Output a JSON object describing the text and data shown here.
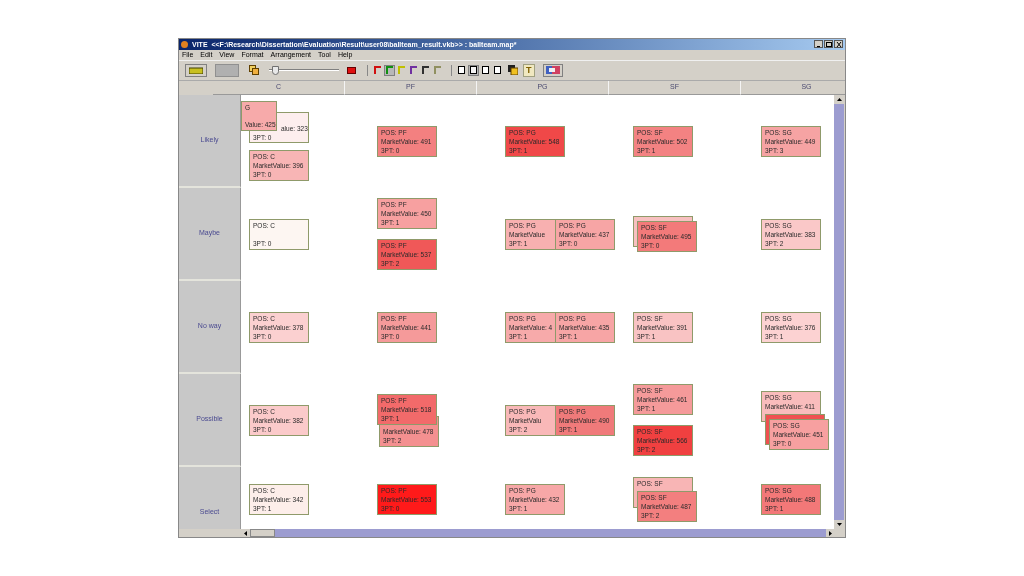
{
  "window": {
    "title": "VITE  <<F:\\Research\\Dissertation\\Evaluation\\Result\\user08\\ballteam_result.vkb>> : ballteam.map*"
  },
  "menu": [
    "File",
    "Edit",
    "View",
    "Format",
    "Arrangement",
    "Tool",
    "Help"
  ],
  "toolbar": {
    "zoom_slider": {
      "level": 0.05
    },
    "line_colors": [
      {
        "color": "#d01010",
        "selected": false
      },
      {
        "color": "#109010",
        "selected": true
      },
      {
        "color": "#c0c000",
        "selected": false
      },
      {
        "color": "#7030a0",
        "selected": false
      },
      {
        "color": "#303030",
        "selected": false
      },
      {
        "color": "#909060",
        "selected": false
      }
    ],
    "fill_colors": [
      {
        "color": "#ffffff",
        "selected": false
      },
      {
        "color": "#f4f4f4",
        "selected": true
      },
      {
        "color": "#ffffff",
        "selected": false
      },
      {
        "color": "#ffffff",
        "selected": false
      }
    ],
    "text_tool": "T"
  },
  "columns": [
    "C",
    "PF",
    "PG",
    "SF",
    "SG"
  ],
  "rows": [
    {
      "label": "Likely",
      "cells": [
        [
          {
            "kind": "corner",
            "cards": [
              {
                "lines": [
                  "G",
                  "Value: 425"
                ],
                "color": "#f7aaaa"
              },
              {
                "lines": [
                  "alue: 323",
                  "3PT: 0"
                ],
                "color": "#fdeeee"
              }
            ]
          },
          {
            "kind": "single",
            "cards": [
              {
                "lines": [
                  "POS: C",
                  "MarketValue: 396",
                  "3PT: 0"
                ],
                "color": "#f8b5b5"
              }
            ]
          }
        ],
        [
          {
            "kind": "single",
            "cards": [
              {
                "lines": [
                  "POS: PF",
                  "MarketValue: 491",
                  "3PT: 0"
                ],
                "color": "#f38080"
              }
            ]
          }
        ],
        [
          {
            "kind": "single",
            "cards": [
              {
                "lines": [
                  "POS: PG",
                  "MarketValue: 548",
                  "3PT: 1"
                ],
                "color": "#f04848"
              }
            ]
          }
        ],
        [
          {
            "kind": "single",
            "cards": [
              {
                "lines": [
                  "POS: SF",
                  "MarketValue: 502",
                  "3PT: 1"
                ],
                "color": "#f38282"
              }
            ]
          }
        ],
        [
          {
            "kind": "single",
            "cards": [
              {
                "lines": [
                  "POS: SG",
                  "MarketValue: 449",
                  "3PT: 3"
                ],
                "color": "#f6a3a3"
              }
            ]
          }
        ]
      ]
    },
    {
      "label": "Maybe",
      "cells": [
        [
          {
            "kind": "single",
            "cards": [
              {
                "lines": [
                  "POS: C",
                  "3PT: 0"
                ],
                "color": "#fdf6f2"
              }
            ]
          }
        ],
        [
          {
            "kind": "single",
            "cards": [
              {
                "lines": [
                  "POS: PF",
                  "MarketValue: 450",
                  "3PT: 1"
                ],
                "color": "#f7a0a0"
              }
            ]
          },
          {
            "kind": "single",
            "cards": [
              {
                "lines": [
                  "POS: PF",
                  "MarketValue: 537",
                  "3PT: 2"
                ],
                "color": "#f05858"
              }
            ]
          }
        ],
        [
          {
            "kind": "right",
            "cards": [
              {
                "lines": [
                  "POS: PG",
                  "MarketValue",
                  "3PT: 1"
                ],
                "color": "#f8b0b0"
              },
              {
                "lines": [
                  "POS: PG",
                  "MarketValue: 437",
                  "3PT: 0"
                ],
                "color": "#f7a5a5"
              }
            ]
          }
        ],
        [
          {
            "kind": "down",
            "cards": [
              {
                "color": "#f8c0c0"
              },
              {
                "lines": [
                  "POS: SF",
                  "MarketValue: 495",
                  "3PT: 0"
                ],
                "color": "#f37a7a"
              }
            ]
          }
        ],
        [
          {
            "kind": "single",
            "cards": [
              {
                "lines": [
                  "POS: SG",
                  "MarketValue: 383",
                  "3PT: 2"
                ],
                "color": "#fac8c8"
              }
            ]
          }
        ]
      ]
    },
    {
      "label": "No way",
      "cells": [
        [
          {
            "kind": "single",
            "cards": [
              {
                "lines": [
                  "POS: C",
                  "MarketValue: 378",
                  "3PT: 0"
                ],
                "color": "#fbd0d0"
              }
            ]
          }
        ],
        [
          {
            "kind": "single",
            "cards": [
              {
                "lines": [
                  "POS: PF",
                  "MarketValue: 441",
                  "3PT: 0"
                ],
                "color": "#f59a9a"
              }
            ]
          }
        ],
        [
          {
            "kind": "right",
            "cards": [
              {
                "lines": [
                  "POS: PG",
                  "MarketValue: 4",
                  "3PT: 1"
                ],
                "color": "#f7aaaa"
              },
              {
                "lines": [
                  "POS: PG",
                  "MarketValue: 435",
                  "3PT: 1"
                ],
                "color": "#f7a5a5"
              }
            ]
          }
        ],
        [
          {
            "kind": "single",
            "cards": [
              {
                "lines": [
                  "POS: SF",
                  "MarketValue: 391",
                  "3PT: 1"
                ],
                "color": "#f9c3c3"
              }
            ]
          }
        ],
        [
          {
            "kind": "single",
            "cards": [
              {
                "lines": [
                  "POS: SG",
                  "MarketValue: 376",
                  "3PT: 1"
                ],
                "color": "#fcd2d2"
              }
            ]
          }
        ]
      ]
    },
    {
      "label": "Possible",
      "cells": [
        [
          {
            "kind": "single",
            "cards": [
              {
                "lines": [
                  "POS: C",
                  "MarketValue: 382",
                  "3PT: 0"
                ],
                "color": "#fbcaca"
              }
            ]
          }
        ],
        [
          {
            "kind": "up",
            "cards": [
              {
                "lines": [
                  "POS: PF",
                  "MarketValue: 518",
                  "3PT: 1"
                ],
                "color": "#f26a6a"
              },
              {
                "lines": [
                  "MarketValue: 478",
                  "3PT: 2"
                ],
                "color": "#f49090"
              }
            ]
          }
        ],
        [
          {
            "kind": "right",
            "cards": [
              {
                "lines": [
                  "POS: PG",
                  "MarketValu",
                  "3PT: 2"
                ],
                "color": "#f9b8b8"
              },
              {
                "lines": [
                  "POS: PG",
                  "MarketValue: 490",
                  "3PT: 1"
                ],
                "color": "#f07a7a"
              }
            ]
          }
        ],
        [
          {
            "kind": "single",
            "cards": [
              {
                "lines": [
                  "POS: SF",
                  "MarketValue: 461",
                  "3PT: 1"
                ],
                "color": "#f59a9a"
              }
            ]
          },
          {
            "kind": "single",
            "cards": [
              {
                "lines": [
                  "POS: SF",
                  "MarketValue: 566",
                  "3PT: 2"
                ],
                "color": "#f04040"
              }
            ]
          }
        ],
        [
          {
            "kind": "down",
            "cards": [
              {
                "lines": [
                  "POS: SG",
                  "MarketValue: 411"
                ],
                "color": "#f9bcbc"
              },
              {
                "color": "#f05050"
              },
              {
                "lines": [
                  "POS: SG",
                  "MarketValue: 451",
                  "3PT: 0"
                ],
                "color": "#f7a0a0"
              }
            ]
          }
        ]
      ]
    },
    {
      "label": "Select",
      "cells": [
        [
          {
            "kind": "single",
            "cards": [
              {
                "lines": [
                  "POS: C",
                  "MarketValue: 342",
                  "3PT: 1"
                ],
                "color": "#fdeeea"
              }
            ]
          }
        ],
        [
          {
            "kind": "single",
            "cards": [
              {
                "lines": [
                  "POS: PF",
                  "MarketValue: 553",
                  "3PT: 0"
                ],
                "color": "#ff1a1a"
              }
            ]
          }
        ],
        [
          {
            "kind": "single",
            "cards": [
              {
                "lines": [
                  "POS: PG",
                  "MarketValue: 432",
                  "3PT: 1"
                ],
                "color": "#f7a7a7"
              }
            ]
          }
        ],
        [
          {
            "kind": "down",
            "cards": [
              {
                "lines": [
                  "POS: SF"
                ],
                "color": "#f8b5b5"
              },
              {
                "lines": [
                  "POS: SF",
                  "MarketValue: 487",
                  "3PT: 2"
                ],
                "color": "#f37f7f"
              }
            ]
          }
        ],
        [
          {
            "kind": "single",
            "cards": [
              {
                "lines": [
                  "POS: SG",
                  "MarketValue: 488",
                  "3PT: 1"
                ],
                "color": "#f37878"
              }
            ]
          }
        ]
      ]
    }
  ]
}
